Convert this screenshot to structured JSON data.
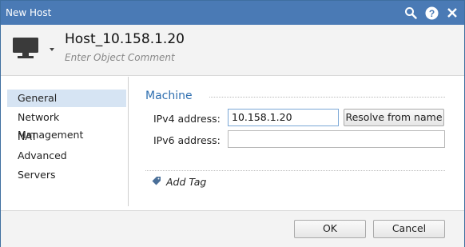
{
  "window": {
    "title": "New Host",
    "title_bar_color": "#4a7ab5",
    "icons": [
      "search-icon",
      "help-icon",
      "close-icon"
    ]
  },
  "header": {
    "host_icon": "monitor-icon",
    "host_name": "Host_10.158.1.20",
    "comment_placeholder": "Enter Object Comment"
  },
  "sidebar": {
    "items": [
      {
        "label": "General",
        "selected": true
      },
      {
        "label": "Network Management",
        "selected": false
      },
      {
        "label": "NAT",
        "selected": false
      },
      {
        "label": "Advanced",
        "selected": false
      },
      {
        "label": "Servers",
        "selected": false
      }
    ],
    "selected_color": "#d6e4f3"
  },
  "main": {
    "section_title": "Machine",
    "accent_color": "#2f6fb0",
    "ipv4_label": "IPv4 address:",
    "ipv4_value": "10.158.1.20",
    "ipv6_label": "IPv6 address:",
    "ipv6_value": "",
    "resolve_button": "Resolve from name",
    "add_tag_label": "Add Tag",
    "add_tag_icon": "tag-icon"
  },
  "footer": {
    "ok_label": "OK",
    "cancel_label": "Cancel"
  }
}
